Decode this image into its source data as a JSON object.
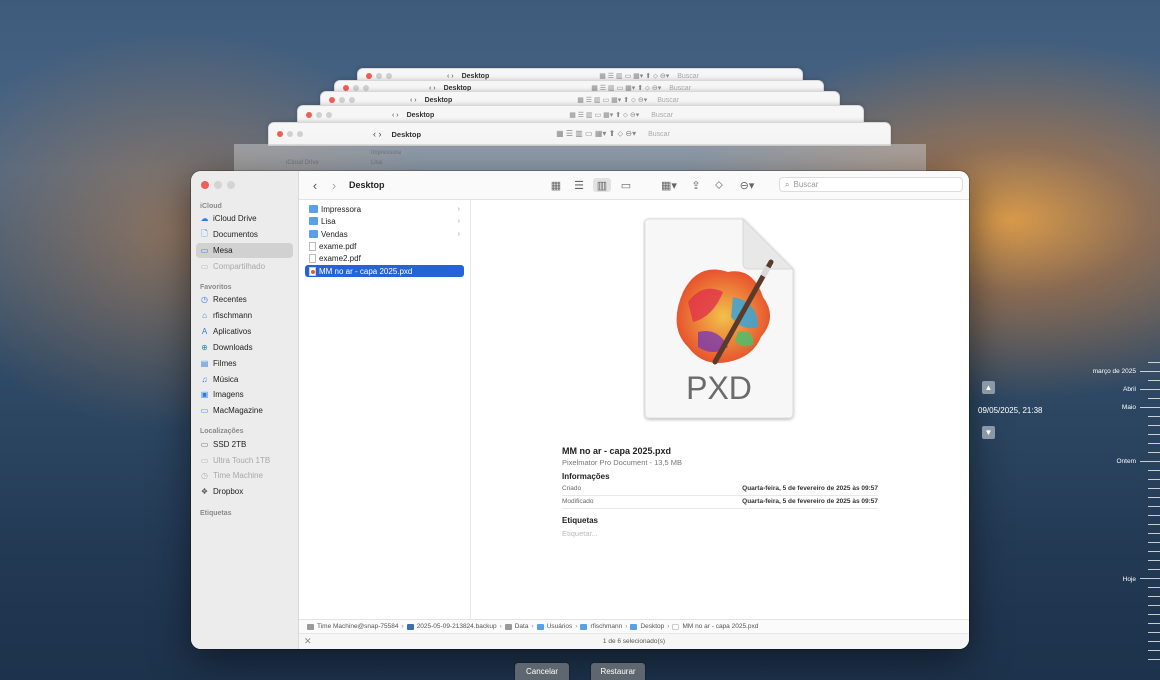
{
  "background_windows": [
    {
      "title": "Desktop",
      "search": "Buscar"
    },
    {
      "title": "Desktop",
      "search": "Buscar"
    },
    {
      "title": "Desktop",
      "search": "Buscar"
    },
    {
      "title": "Desktop",
      "search": "Buscar"
    },
    {
      "title": "Desktop",
      "search": "Buscar"
    }
  ],
  "background_partial": {
    "item1": "iCloud Drive",
    "item2": "Impressora",
    "item3": "Lisa"
  },
  "window": {
    "title": "Desktop",
    "search_placeholder": "Buscar"
  },
  "sidebar": {
    "sections": {
      "icloud": "iCloud",
      "favoritos": "Favoritos",
      "localizacoes": "Localizações",
      "etiquetas": "Etiquetas"
    },
    "items": [
      {
        "label": "iCloud Drive",
        "icon": "cloud-icon"
      },
      {
        "label": "Documentos",
        "icon": "document-icon"
      },
      {
        "label": "Mesa",
        "icon": "desktop-icon",
        "selected": true
      },
      {
        "label": "Compartilhado",
        "icon": "shared-folder-icon",
        "disabled": true
      },
      {
        "label": "Recentes",
        "icon": "clock-icon"
      },
      {
        "label": "rfischmann",
        "icon": "home-icon"
      },
      {
        "label": "Aplicativos",
        "icon": "apps-icon"
      },
      {
        "label": "Downloads",
        "icon": "download-icon"
      },
      {
        "label": "Filmes",
        "icon": "film-icon"
      },
      {
        "label": "Música",
        "icon": "music-icon"
      },
      {
        "label": "Imagens",
        "icon": "image-icon"
      },
      {
        "label": "MacMagazine",
        "icon": "folder-icon"
      },
      {
        "label": "SSD 2TB",
        "icon": "drive-icon"
      },
      {
        "label": "Ultra Touch 1TB",
        "icon": "drive-icon",
        "disabled": true
      },
      {
        "label": "Time Machine",
        "icon": "time-machine-icon",
        "disabled": true
      },
      {
        "label": "Dropbox",
        "icon": "dropbox-icon"
      }
    ]
  },
  "files": [
    {
      "name": "Impressora",
      "type": "folder"
    },
    {
      "name": "Lisa",
      "type": "folder"
    },
    {
      "name": "Vendas",
      "type": "folder"
    },
    {
      "name": "exame.pdf",
      "type": "pdf"
    },
    {
      "name": "exame2.pdf",
      "type": "pdf"
    },
    {
      "name": "MM no ar - capa 2025.pxd",
      "type": "pxd",
      "selected": true
    }
  ],
  "preview": {
    "icon_label": "PXD",
    "name": "MM no ar - capa 2025.pxd",
    "kind": "Pixelmator Pro Document - 13,5 MB",
    "info_header": "Informações",
    "created_label": "Criado",
    "created_value": "Quarta-feira, 5 de fevereiro de 2025 às 09:57",
    "modified_label": "Modificado",
    "modified_value": "Quarta-feira, 5 de fevereiro de 2025 às 09:57",
    "tags_header": "Etiquetas",
    "tags_placeholder": "Etiquetar..."
  },
  "path": [
    "Time Machine@snap-75584",
    "2025-05-09-213824.backup",
    "Data",
    "Usuários",
    "rfischmann",
    "Desktop",
    "MM no ar - capa 2025.pxd"
  ],
  "status": "1 de 6 selecionado(s)",
  "buttons": {
    "cancel": "Cancelar",
    "restore": "Restaurar"
  },
  "time_machine": {
    "current": "09/05/2025, 21:38",
    "timeline": [
      "março de 2025",
      "Abril",
      "Maio",
      "Ontem",
      "Hoje"
    ]
  }
}
